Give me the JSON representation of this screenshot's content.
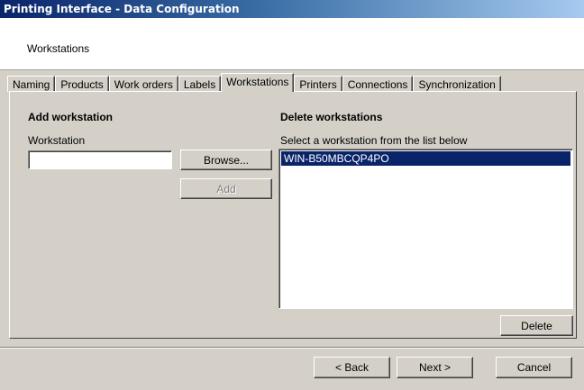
{
  "window": {
    "title": "Printing Interface - Data Configuration"
  },
  "header": {
    "title": "Workstations"
  },
  "tabs": [
    {
      "label": "Naming"
    },
    {
      "label": "Products"
    },
    {
      "label": "Work orders"
    },
    {
      "label": "Labels"
    },
    {
      "label": "Workstations"
    },
    {
      "label": "Printers"
    },
    {
      "label": "Connections"
    },
    {
      "label": "Synchronization"
    }
  ],
  "active_tab": "Workstations",
  "add_section": {
    "title": "Add workstation",
    "field_label": "Workstation",
    "field_value": "",
    "browse_label": "Browse...",
    "add_label": "Add"
  },
  "delete_section": {
    "title": "Delete workstations",
    "instruction": "Select a workstation from the list below",
    "items": [
      "WIN-B50MBCQP4PO"
    ],
    "selected_item": "WIN-B50MBCQP4PO",
    "delete_label": "Delete"
  },
  "footer": {
    "back_label": "< Back",
    "next_label": "Next >",
    "cancel_label": "Cancel"
  },
  "colors": {
    "title_gradient_start": "#0a246a",
    "title_gradient_end": "#a6caf0",
    "selection": "#0a246a",
    "face": "#d4d0c8"
  }
}
